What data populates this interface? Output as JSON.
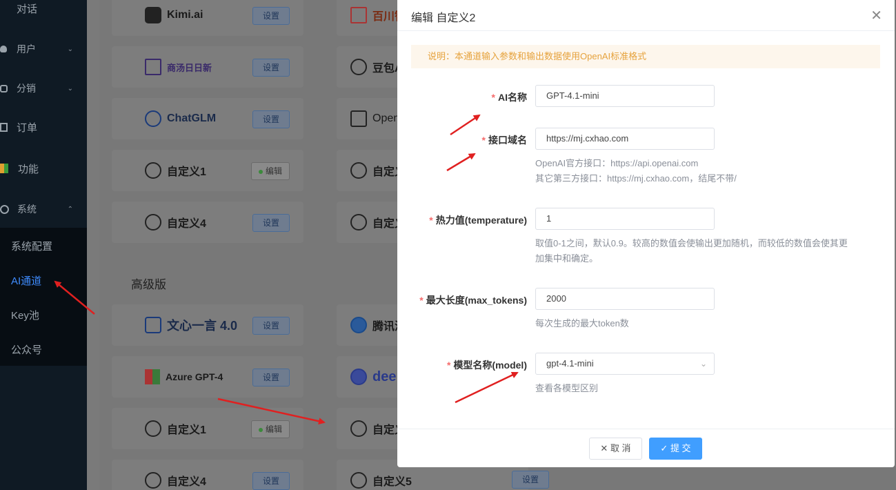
{
  "sidebar": {
    "items": [
      {
        "label": "对话",
        "icon": "chat-icon"
      },
      {
        "label": "用户",
        "icon": "user-icon"
      },
      {
        "label": "分销",
        "icon": "share-icon"
      },
      {
        "label": "订单",
        "icon": "order-icon"
      },
      {
        "label": "功能",
        "icon": "apps-icon"
      },
      {
        "label": "系统",
        "icon": "gear-icon"
      }
    ],
    "submenu": [
      "系统配置",
      "AI通道",
      "Key池",
      "公众号"
    ]
  },
  "cards": {
    "set_label": "设置",
    "edit_label": "编辑",
    "names": {
      "kimi": "Kimi.ai",
      "baichuan": "百川智",
      "sense": "商汤日日新",
      "doubao": "豆包A",
      "chatglm": "ChatGLM",
      "openai": "Open",
      "custom1": "自定义1",
      "custom_r1": "自定义",
      "custom4": "自定义4",
      "custom_r2": "自定义",
      "wenxin": "文心一言 4.0",
      "tencent": "腾讯混",
      "azure": "Azure GPT-4",
      "deepseek": "dee",
      "custom1b": "自定义1",
      "custom_r3": "自定义",
      "custom4b": "自定义4",
      "custom5": "自定义5"
    },
    "section_label": "高级版"
  },
  "modal": {
    "title": "编辑 自定义2",
    "notice": "说明：本通道输入参数和输出数据使用OpenAI标准格式",
    "fields": {
      "ai_name": {
        "label": "AI名称",
        "value": "GPT-4.1-mini"
      },
      "endpoint": {
        "label": "接口域名",
        "value": "https://mj.cxhao.com",
        "help1": "OpenAI官方接口：https://api.openai.com",
        "help2": "其它第三方接口：https://mj.cxhao.com，结尾不带/"
      },
      "temperature": {
        "label": "热力值(temperature)",
        "value": "1",
        "help1": "取值0-1之间，默认0.9。较高的数值会使输出更加随机，而较低的数值会使其更",
        "help2": "加集中和确定。"
      },
      "max_tokens": {
        "label": "最大长度(max_tokens)",
        "value": "2000",
        "help": "每次生成的最大token数"
      },
      "model": {
        "label": "模型名称(model)",
        "value": "gpt-4.1-mini",
        "help": "查看各模型区别"
      }
    },
    "cancel_label": "取 消",
    "submit_label": "提 交"
  },
  "colors": {
    "accent": "#409eff",
    "warning": "#e6a23c",
    "required": "#f56c6c",
    "arrow": "#e02020"
  }
}
